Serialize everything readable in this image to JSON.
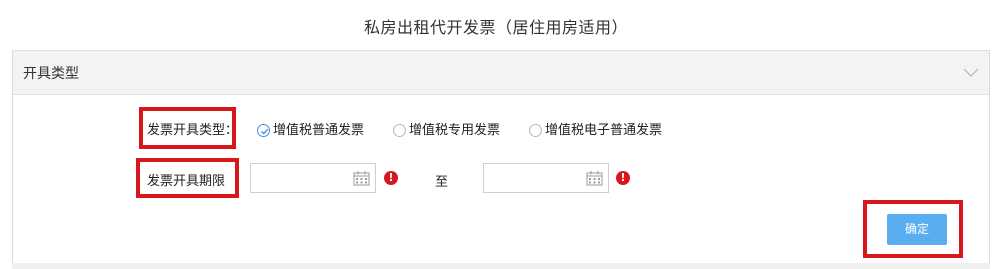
{
  "page": {
    "title": "私房出租代开发票（居住用房适用）"
  },
  "panel": {
    "header_title": "开具类型",
    "collapse_icon": "chevron-down-icon"
  },
  "form": {
    "invoice_type_label": "发票开具类型：",
    "invoice_type_options": [
      {
        "label": "增值税普通发票",
        "checked": true
      },
      {
        "label": "增值税专用发票",
        "checked": false
      },
      {
        "label": "增值税电子普通发票",
        "checked": false
      }
    ],
    "period_label": "发票开具期限",
    "period_start_value": "",
    "period_end_value": "",
    "to_label": "至",
    "error_mark": "!",
    "calendar_icon": "calendar-icon",
    "error_icon": "exclamation-circle-icon"
  },
  "actions": {
    "confirm_label": "确定"
  },
  "colors": {
    "highlight": "#d9161c",
    "button": "#5aaeef",
    "radio_checked": "#3a8ee6"
  }
}
